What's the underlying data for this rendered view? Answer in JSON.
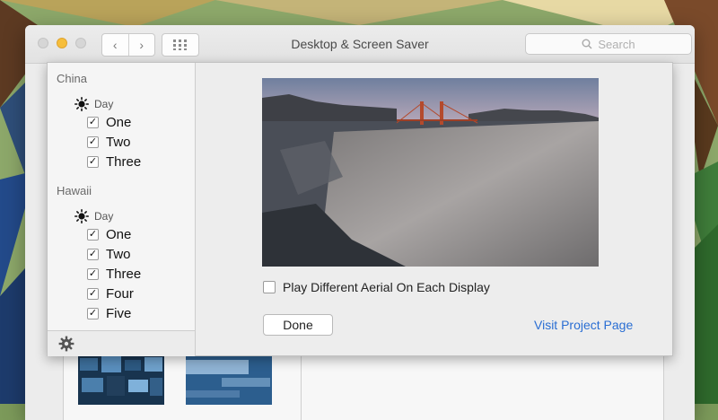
{
  "window": {
    "title": "Desktop & Screen Saver",
    "search_placeholder": "Search",
    "back_icon": "‹",
    "forward_icon": "›"
  },
  "sidebar": {
    "groups": [
      {
        "name": "China",
        "time_of_day": "Day",
        "items": [
          {
            "label": "One",
            "checked": true
          },
          {
            "label": "Two",
            "checked": true
          },
          {
            "label": "Three",
            "checked": true
          }
        ]
      },
      {
        "name": "Hawaii",
        "time_of_day": "Day",
        "items": [
          {
            "label": "One",
            "checked": true
          },
          {
            "label": "Two",
            "checked": true
          },
          {
            "label": "Three",
            "checked": true
          },
          {
            "label": "Four",
            "checked": true
          },
          {
            "label": "Five",
            "checked": true
          }
        ]
      }
    ]
  },
  "options": {
    "play_different_aerial_label": "Play Different Aerial On Each Display",
    "play_different_aerial_checked": false
  },
  "buttons": {
    "done_label": "Done",
    "visit_project_label": "Visit Project Page"
  },
  "colors": {
    "accent_link": "#2a6ed3",
    "minimize_button": "#f6be3b"
  }
}
